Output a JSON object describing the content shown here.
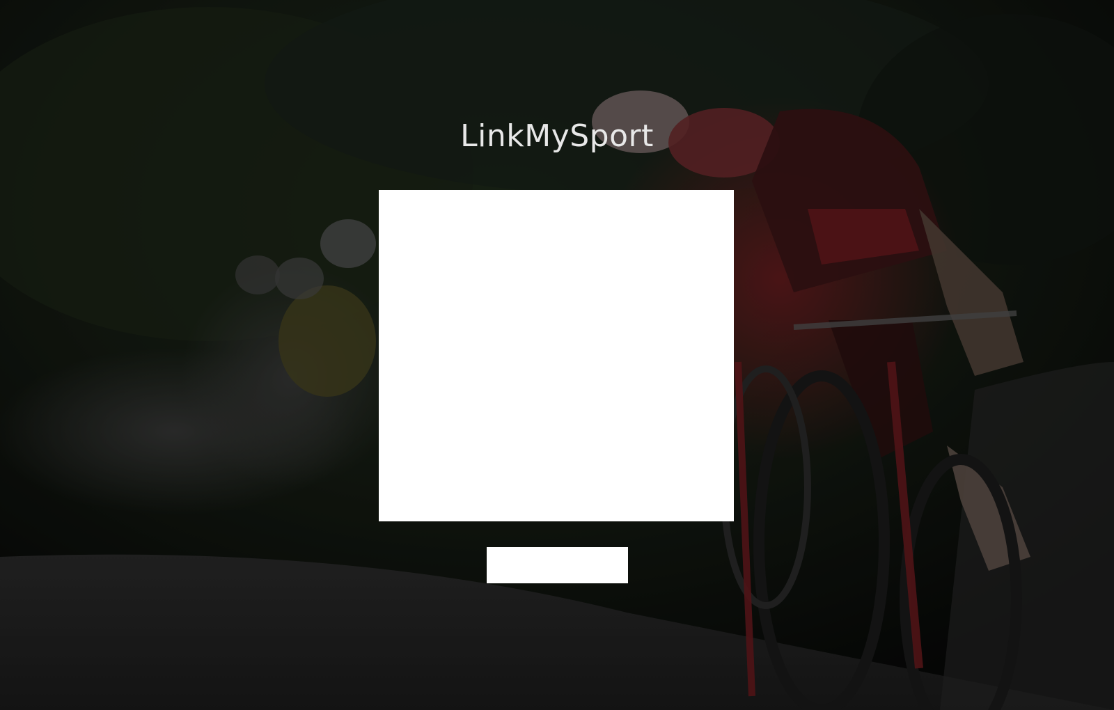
{
  "app": {
    "title": "LinkMySport"
  },
  "background": {
    "description_icon": "cycling-peloton-photo",
    "tint": "#000000"
  },
  "login_panel": {
    "background_color": "#ffffff"
  },
  "submit_button": {
    "label": "",
    "background_color": "#ffffff"
  }
}
